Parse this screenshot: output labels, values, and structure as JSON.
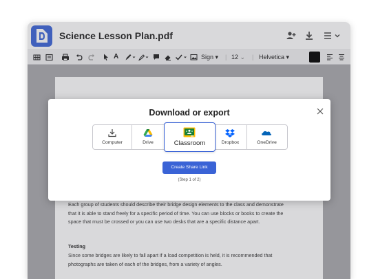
{
  "header": {
    "title": "Science Lesson Plan.pdf",
    "icons": [
      "add-user-icon",
      "download-icon",
      "menu-icon",
      "chevron-down-icon"
    ]
  },
  "toolbar": {
    "sign_label": "Sign",
    "font_size": "12",
    "font_family": "Helvetica",
    "text_color": "#000000"
  },
  "document": {
    "paragraph1": "Each group of students should describe their bridge design elements to the class and demonstrate that it is able to stand freely for a specific period of time. You can use blocks or books to create the space that must be crossed or you can use two desks that are a specific distance apart.",
    "heading": "Testing",
    "paragraph2": "Since some bridges are likely to fall apart if a load competition is held, it is recommended that photographs are taken of each of the bridges, from a variety of angles."
  },
  "dialog": {
    "title": "Download or export",
    "options": [
      {
        "label": "Computer",
        "icon": "download-to-computer-icon"
      },
      {
        "label": "Drive",
        "icon": "google-drive-icon"
      },
      {
        "label": "Classroom",
        "icon": "google-classroom-icon"
      },
      {
        "label": "Dropbox",
        "icon": "dropbox-icon"
      },
      {
        "label": "OneDrive",
        "icon": "onedrive-icon"
      }
    ],
    "selected_option": "Classroom",
    "share_button": "Create Share Link",
    "step": "(Step 1 of 2)"
  },
  "colors": {
    "accent": "#3a63d6",
    "logo": "#3b64d8",
    "overlay": "#a9a9ae"
  }
}
